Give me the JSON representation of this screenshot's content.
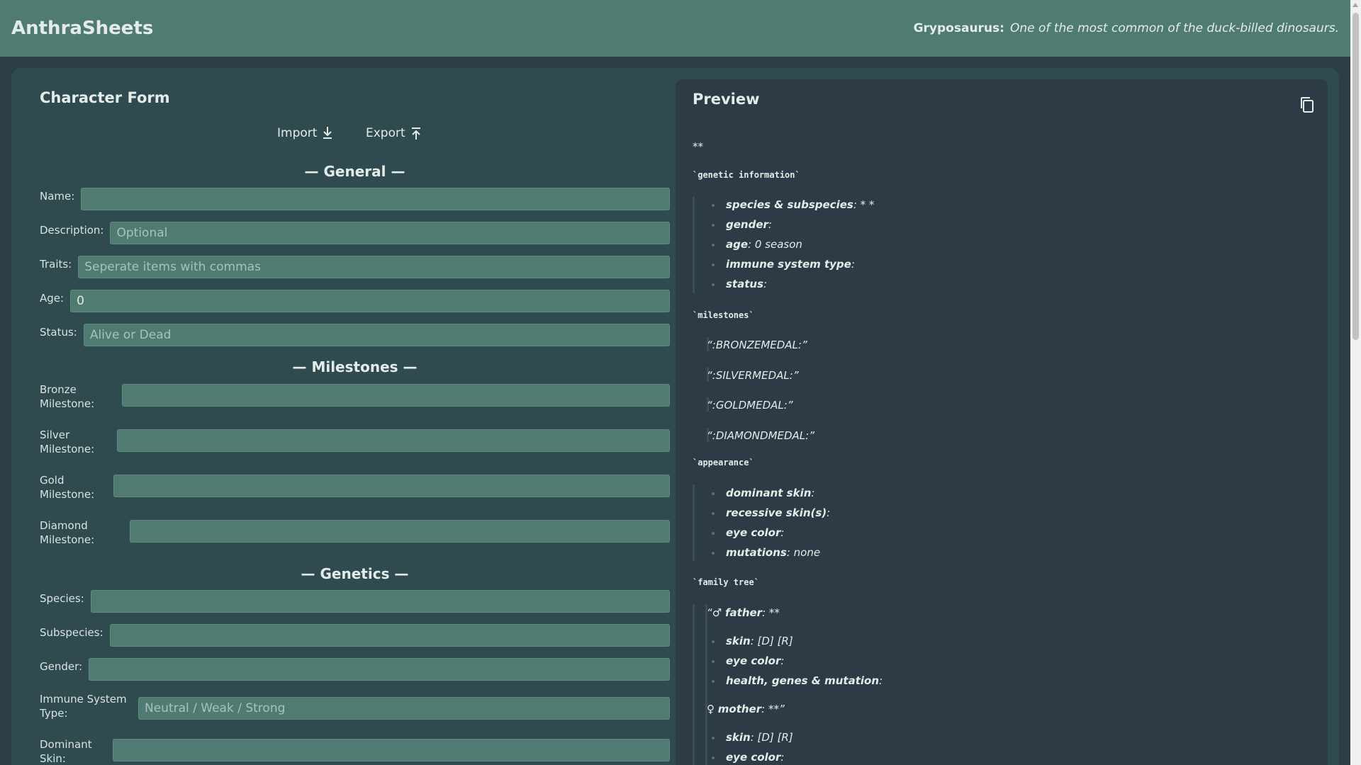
{
  "header": {
    "brand": "AnthraSheets",
    "fact_name": "Gryposaurus:",
    "fact_text": "One of the most common of the duck-billed dinosaurs."
  },
  "form": {
    "title": "Character Form",
    "import_label": "Import",
    "export_label": "Export",
    "sections": {
      "general": "— General —",
      "milestones": "— Milestones —",
      "genetics": "— Genetics —"
    },
    "fields": {
      "name": {
        "label": "Name:",
        "value": "",
        "placeholder": ""
      },
      "description": {
        "label": "Description:",
        "value": "",
        "placeholder": "Optional"
      },
      "traits": {
        "label": "Traits:",
        "value": "",
        "placeholder": "Seperate items with commas"
      },
      "age": {
        "label": "Age:",
        "value": "0",
        "placeholder": ""
      },
      "status": {
        "label": "Status:",
        "value": "",
        "placeholder": "Alive or Dead"
      },
      "bronze": {
        "label": "Bronze Milestone:",
        "value": "",
        "placeholder": ""
      },
      "silver": {
        "label": "Silver Milestone:",
        "value": "",
        "placeholder": ""
      },
      "gold": {
        "label": "Gold Milestone:",
        "value": "",
        "placeholder": ""
      },
      "diamond": {
        "label": "Diamond Milestone:",
        "value": "",
        "placeholder": ""
      },
      "species": {
        "label": "Species:",
        "value": "",
        "placeholder": ""
      },
      "subspecies": {
        "label": "Subspecies:",
        "value": "",
        "placeholder": ""
      },
      "gender": {
        "label": "Gender:",
        "value": "",
        "placeholder": ""
      },
      "immune": {
        "label": "Immune System Type:",
        "value": "",
        "placeholder": "Neutral / Weak / Strong"
      },
      "dominant_skin": {
        "label": "Dominant Skin:",
        "value": "",
        "placeholder": ""
      }
    }
  },
  "preview": {
    "title": "Preview",
    "top_line": "**",
    "genetic_heading": "`genetic information`",
    "genetic_items": [
      {
        "key": "species & subspecies",
        "val": ": * *"
      },
      {
        "key": "gender",
        "val": ":"
      },
      {
        "key": "age",
        "val": ": 0 season"
      },
      {
        "key": "immune system type",
        "val": ":"
      },
      {
        "key": "status",
        "val": ":"
      }
    ],
    "milestones_heading": "`milestones`",
    "milestones": [
      "“:BRONZEMEDAL:”",
      "“:SILVERMEDAL:”",
      "“:GOLDMEDAL:”",
      "“:DIAMONDMEDAL:”"
    ],
    "appearance_heading": "`appearance`",
    "appearance_items": [
      {
        "key": "dominant skin",
        "val": ":"
      },
      {
        "key": "recessive skin(s)",
        "val": ":"
      },
      {
        "key": "eye color",
        "val": ":"
      },
      {
        "key": "mutations",
        "val": ": none"
      }
    ],
    "family_heading": "`family tree`",
    "father_prefix": "“♂ ",
    "father_key": "father",
    "father_val": ": **",
    "father_items": [
      {
        "key": "skin",
        "val": ": [D] [R]"
      },
      {
        "key": "eye color",
        "val": ":"
      },
      {
        "key": "health, genes & mutation",
        "val": ":"
      }
    ],
    "mother_prefix": "♀ ",
    "mother_key": "mother",
    "mother_val": ": **”",
    "mother_items": [
      {
        "key": "skin",
        "val": ": [D] [R]"
      },
      {
        "key": "eye color",
        "val": ":"
      }
    ]
  },
  "colors": {
    "header_bg": "#4f7b72",
    "page_bg": "#2c3e46",
    "panel_bg": "#2f4b4f",
    "preview_bg": "#2c3b45",
    "input_bg": "#4f7b72"
  }
}
